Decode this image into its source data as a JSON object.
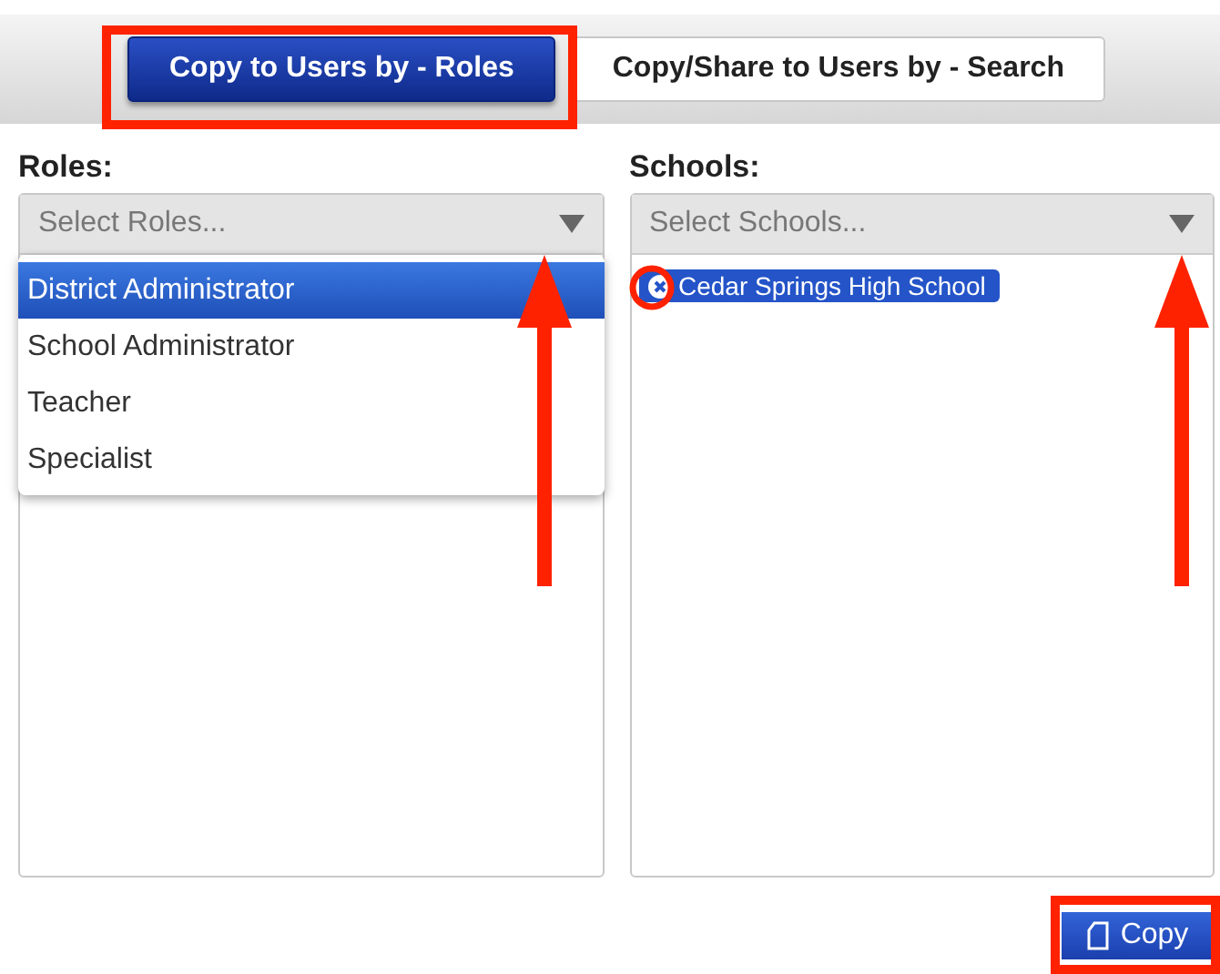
{
  "tabs": [
    {
      "label": "Copy to Users by - Roles",
      "selected": true
    },
    {
      "label": "Copy/Share to Users by - Search",
      "selected": false
    }
  ],
  "roles": {
    "label": "Roles:",
    "placeholder": "Select Roles...",
    "expanded": true,
    "options": [
      {
        "label": "District Administrator",
        "selected": true
      },
      {
        "label": "School Administrator",
        "selected": false
      },
      {
        "label": "Teacher",
        "selected": false
      },
      {
        "label": "Specialist",
        "selected": false
      }
    ]
  },
  "schools": {
    "label": "Schools:",
    "placeholder": "Select Schools...",
    "expanded": false,
    "selected_items": [
      {
        "label": "Cedar Springs High School"
      }
    ]
  },
  "copy_button": {
    "label": "Copy"
  }
}
